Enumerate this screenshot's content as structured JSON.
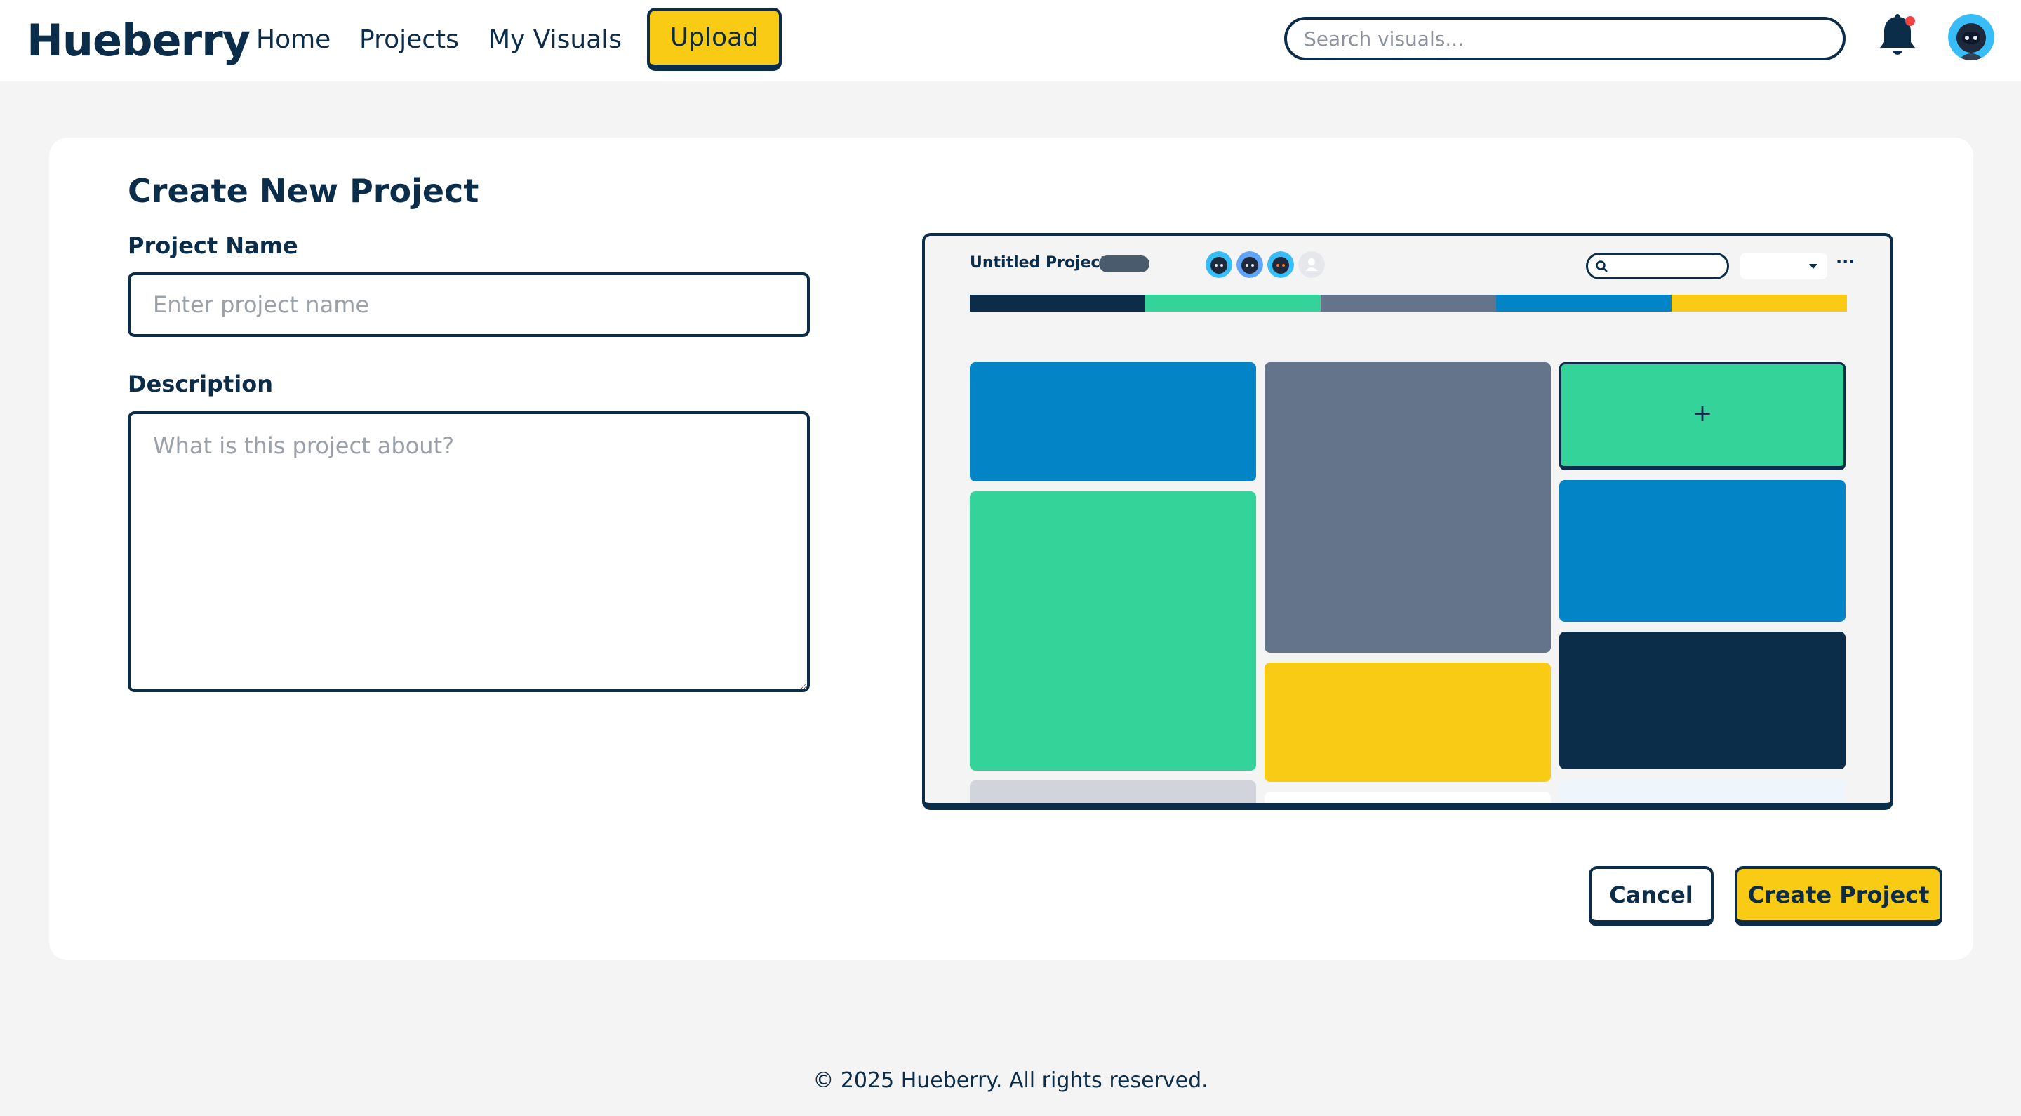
{
  "header": {
    "logo": "Hueberry",
    "nav": [
      {
        "label": "Home"
      },
      {
        "label": "Projects"
      },
      {
        "label": "My Visuals"
      }
    ],
    "upload_label": "Upload",
    "search_placeholder": "Search visuals..."
  },
  "form": {
    "title": "Create New Project",
    "name_label": "Project Name",
    "name_placeholder": "Enter project name",
    "name_value": "",
    "description_label": "Description",
    "description_placeholder": "What is this project about?",
    "description_value": ""
  },
  "preview": {
    "project_title": "Untitled Project",
    "add_tile_label": "+",
    "more_label": "···",
    "palette": [
      "#0b2d4a",
      "#34d399",
      "#64748b",
      "#0284c7",
      "#f9cb14"
    ]
  },
  "actions": {
    "cancel_label": "Cancel",
    "create_label": "Create Project"
  },
  "footer": {
    "copyright": "© 2025 Hueberry. All rights reserved."
  },
  "colors": {
    "navy": "#0b2d4a",
    "accent_yellow": "#f9cb14",
    "notification_dot": "#ef4444"
  }
}
